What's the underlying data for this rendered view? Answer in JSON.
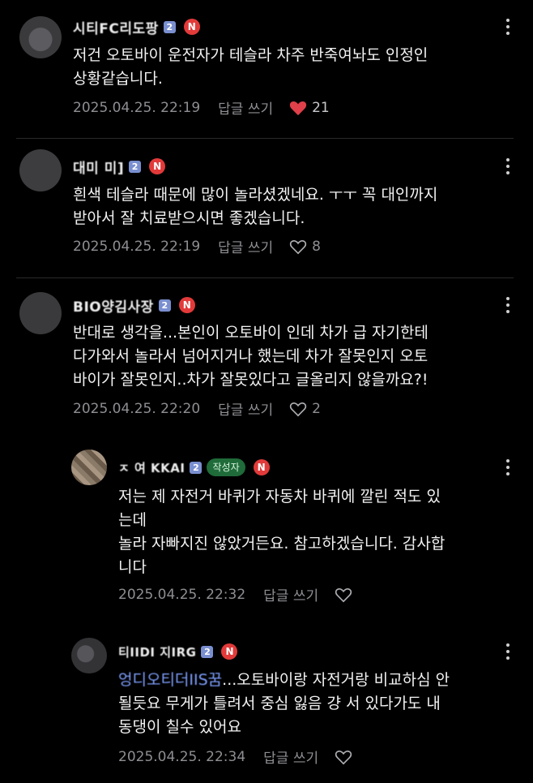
{
  "comments": [
    {
      "nickname": "시티FC리도팡",
      "level": "2",
      "n_badge": "N",
      "body": "저건 오토바이 운전자가 테슬라 차주 반죽여놔도 인정인\n상황같습니다.",
      "date": "2025.04.25. 22:19",
      "reply": "답글 쓰기",
      "likes": "21",
      "liked": true
    },
    {
      "nickname": "대미 미]",
      "level": "2",
      "n_badge": "N",
      "body": "흰색 테슬라 때문에 많이 놀라셨겠네요. ㅜㅜ 꼭 대인까지\n받아서 잘 치료받으시면 좋겠습니다.",
      "date": "2025.04.25. 22:19",
      "reply": "답글 쓰기",
      "likes": "8",
      "liked": false
    },
    {
      "nickname": "BIO양김사장",
      "level": "2",
      "n_badge": "N",
      "body": "반대로 생각을...본인이 오토바이 인데 차가 급 자기한테\n다가와서 놀라서 넘어지거나 했는데 차가 잘못인지 오토\n바이가 잘못인지..차가 잘못있다고 글올리지 않을까요?!",
      "date": "2025.04.25. 22:20",
      "reply": "답글 쓰기",
      "likes": "2",
      "liked": false
    },
    {
      "nickname": "ㅈ 여 KKAI",
      "level": "2",
      "writer_badge": "작성자",
      "n_badge": "N",
      "body": "저는 제 자전거 바퀴가 자동차 바퀴에 깔린 적도 있\n는데\n놀라 자빠지진 않았거든요. 참고하겠습니다. 감사합\n니다",
      "date": "2025.04.25. 22:32",
      "reply": "답글 쓰기",
      "likes": "",
      "liked": false
    },
    {
      "nickname": "티IIDI 지IRG",
      "level": "2",
      "n_badge": "N",
      "mention": "엉디오티더IIS꿈",
      "body": "...오토바이랑 자전거랑 비교하심 안\n될듯요 무게가 틀려서 중심 잃음 걍 서 있다가도 내\n동댕이 칠수 있어요",
      "date": "2025.04.25. 22:34",
      "reply": "답글 쓰기",
      "likes": "",
      "liked": false
    }
  ],
  "colors": {
    "background": "#000000",
    "text": "#f2f2f2",
    "meta": "#8e8e93",
    "like_active": "#e0404a",
    "n_badge": "#e23a3a",
    "writer_badge": "#1f6b3a",
    "mention": "#7fa0ff"
  }
}
